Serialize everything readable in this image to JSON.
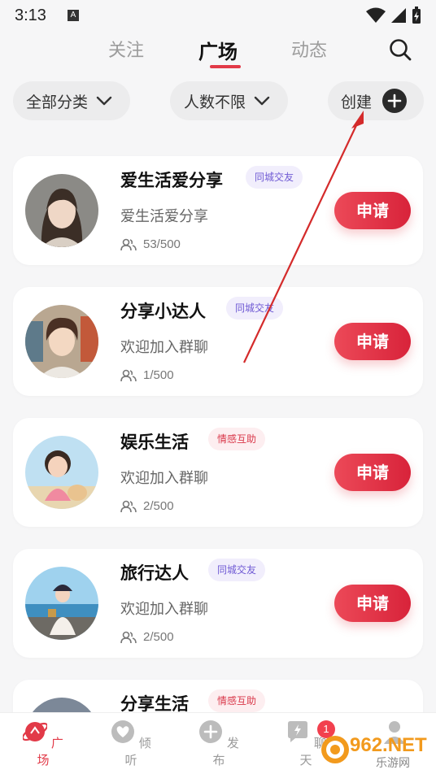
{
  "status": {
    "time": "3:13",
    "notif_letter": "A"
  },
  "tabs": [
    {
      "label": "关注"
    },
    {
      "label": "广场",
      "active": true
    },
    {
      "label": "动态"
    }
  ],
  "filters": {
    "category": "全部分类",
    "people": "人数不限",
    "create": "创建"
  },
  "groups": [
    {
      "name": "爱生活爱分享",
      "tag": "同城交友",
      "tag_type": "city",
      "desc": "爱生活爱分享",
      "members": "53/500",
      "action": "申请",
      "avatar": "girl-portrait"
    },
    {
      "name": "分享小达人",
      "tag": "同城交友",
      "tag_type": "city",
      "desc": "欢迎加入群聊",
      "members": "1/500",
      "action": "申请",
      "avatar": "boy-anime"
    },
    {
      "name": "娱乐生活",
      "tag": "情感互助",
      "tag_type": "emo",
      "desc": "欢迎加入群聊",
      "members": "2/500",
      "action": "申请",
      "avatar": "kid-with-dog"
    },
    {
      "name": "旅行达人",
      "tag": "同城交友",
      "tag_type": "city",
      "desc": "欢迎加入群聊",
      "members": "2/500",
      "action": "申请",
      "avatar": "traveler-seaside"
    },
    {
      "name": "分享生活",
      "tag": "情感互助",
      "tag_type": "emo",
      "desc": "",
      "members": "",
      "action": "",
      "avatar": "person"
    }
  ],
  "nav": [
    {
      "label": "广场",
      "icon": "plaza-icon",
      "active": true
    },
    {
      "label": "倾听",
      "icon": "heart-icon"
    },
    {
      "label": "发布",
      "icon": "plus-icon"
    },
    {
      "label": "聊天",
      "icon": "chat-icon",
      "badge": "1"
    },
    {
      "label": "",
      "icon": "profile-icon"
    }
  ],
  "watermark": {
    "text": "962.NET",
    "sub": "乐游网"
  },
  "colors": {
    "accent": "#e23a48",
    "city_tag_text": "#6f5ad4",
    "emo_tag_text": "#d9384a"
  }
}
